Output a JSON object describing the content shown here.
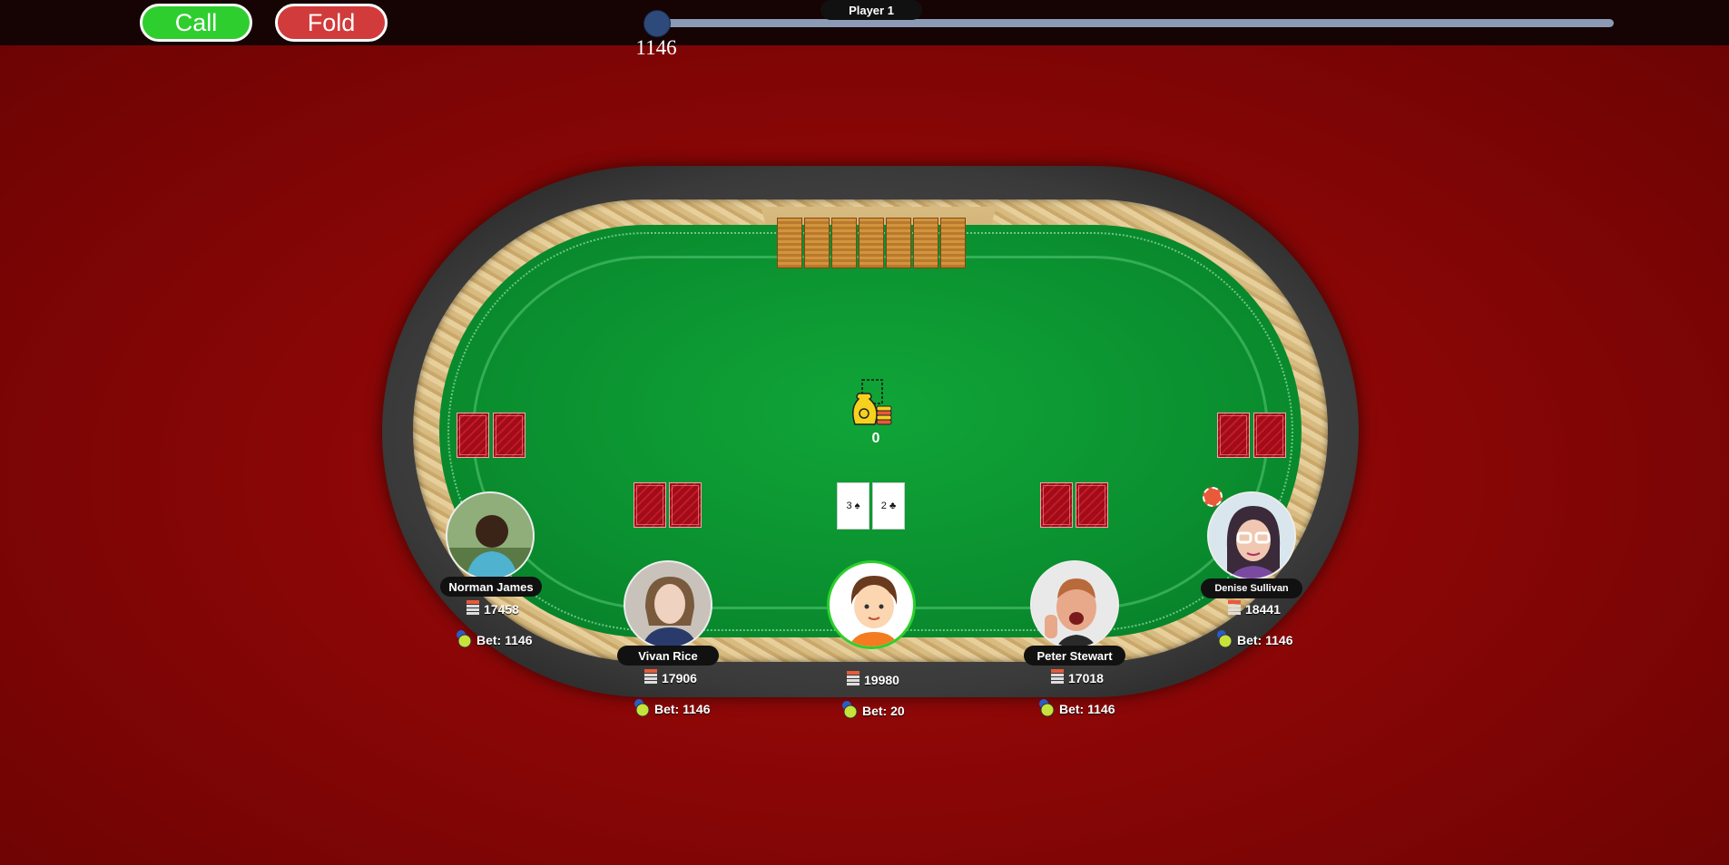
{
  "controls": {
    "call_label": "Call",
    "fold_label": "Fold",
    "raise_value": "1146"
  },
  "pot": {
    "value": "0"
  },
  "community_cards": [
    "3 ♠",
    "2 ♣"
  ],
  "players": [
    {
      "name": "Norman James",
      "chips": "17458",
      "bet": "Bet: 1146"
    },
    {
      "name": "Vivan Rice",
      "chips": "17906",
      "bet": "Bet: 1146"
    },
    {
      "name": "Player 1",
      "chips": "19980",
      "bet": "Bet: 20"
    },
    {
      "name": "Peter Stewart",
      "chips": "17018",
      "bet": "Bet: 1146"
    },
    {
      "name": "Denise Sullivan",
      "chips": "18441",
      "bet": "Bet: 1146"
    }
  ],
  "colors": {
    "call": "#2fce2f",
    "fold": "#d23b3b",
    "felt": "#0a8f2f",
    "background": "#8a0606",
    "active_player": "#2bd02b"
  },
  "icons": [
    "pot-money-bag-icon",
    "chip-stack-icon",
    "bet-chip-icon",
    "dealer-button-icon"
  ]
}
